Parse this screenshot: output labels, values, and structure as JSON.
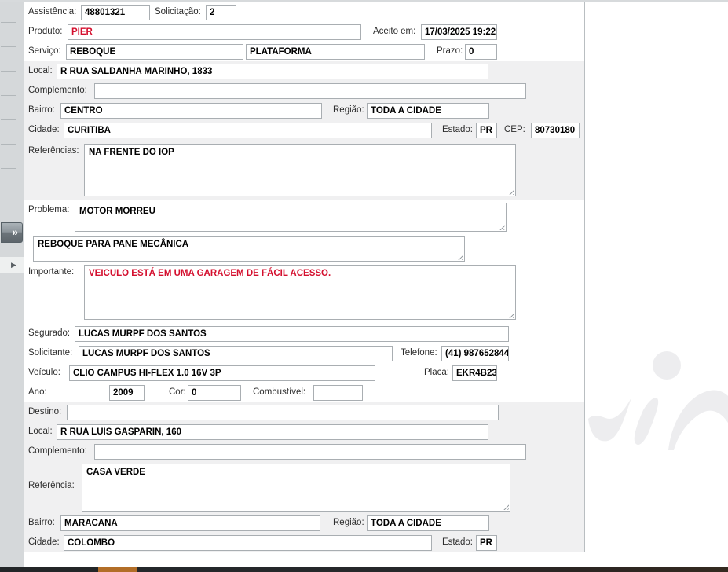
{
  "colors": {
    "red_text": "#d40f2e",
    "accent_orange": "#b26e28",
    "section_gray": "#f0f0f1",
    "strip_gray": "#d5d8da"
  },
  "sidebar": {
    "collapse_glyph": "»",
    "expand_glyph": "▶"
  },
  "form": {
    "assistencia": {
      "label": "Assistência:",
      "value": "48801321"
    },
    "solicitacao": {
      "label": "Solicitação:",
      "value": "2"
    },
    "produto": {
      "label": "Produto:",
      "value": "PIER"
    },
    "aceito_em": {
      "label": "Aceito em:",
      "value": "17/03/2025 19:22"
    },
    "servico": {
      "label": "Serviço:",
      "value": "REBOQUE",
      "value2": "PLATAFORMA"
    },
    "prazo": {
      "label": "Prazo:",
      "value": "0"
    },
    "local": {
      "label": "Local:",
      "value": "R RUA SALDANHA MARINHO, 1833"
    },
    "complemento": {
      "label": "Complemento:",
      "value": ""
    },
    "bairro": {
      "label": "Bairro:",
      "value": "CENTRO"
    },
    "regiao": {
      "label": "Região:",
      "value": "TODA A CIDADE"
    },
    "cidade": {
      "label": "Cidade:",
      "value": "CURITIBA"
    },
    "estado": {
      "label": "Estado:",
      "value": "PR"
    },
    "cep": {
      "label": "CEP:",
      "value": "80730180"
    },
    "referencias": {
      "label": "Referências:",
      "value": "NA FRENTE DO IOP"
    },
    "problema": {
      "label": "Problema:",
      "value": "MOTOR MORREU"
    },
    "problema2": {
      "value": "REBOQUE PARA PANE MECÂNICA"
    },
    "importante": {
      "label": "Importante:",
      "value": "VEICULO ESTÁ EM UMA GARAGEM DE FÁCIL ACESSO."
    },
    "segurado": {
      "label": "Segurado:",
      "value": "LUCAS MURPF DOS SANTOS"
    },
    "solicitante": {
      "label": "Solicitante:",
      "value": "LUCAS MURPF DOS SANTOS"
    },
    "telefone": {
      "label": "Telefone:",
      "value": "(41) 987652844"
    },
    "veiculo": {
      "label": "Veículo:",
      "value": "CLIO CAMPUS HI-FLEX 1.0 16V 3P"
    },
    "placa": {
      "label": "Placa:",
      "value": "EKR4B23"
    },
    "ano": {
      "label": "Ano:",
      "value": "2009"
    },
    "cor": {
      "label": "Cor:",
      "value": "0"
    },
    "combustivel": {
      "label": "Combustível:",
      "value": ""
    }
  },
  "destino_section": {
    "destino": {
      "label": "Destino:",
      "value": ""
    },
    "local": {
      "label": "Local:",
      "value": "R RUA LUIS GASPARIN, 160"
    },
    "complemento": {
      "label": "Complemento:",
      "value": ""
    },
    "referencia": {
      "label": "Referência:",
      "value": "CASA VERDE"
    },
    "bairro": {
      "label": "Bairro:",
      "value": "MARACANA"
    },
    "regiao": {
      "label": "Região:",
      "value": "TODA A CIDADE"
    },
    "cidade": {
      "label": "Cidade:",
      "value": "COLOMBO"
    },
    "estado": {
      "label": "Estado:",
      "value": "PR"
    }
  }
}
